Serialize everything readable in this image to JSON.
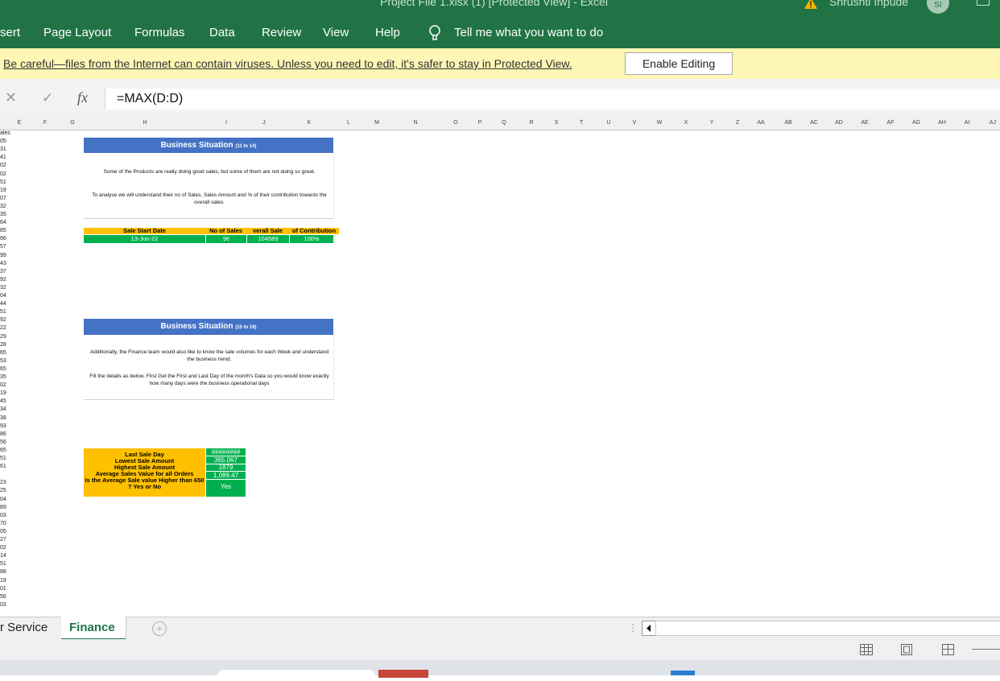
{
  "window": {
    "title": "Project File 1.xlsx (1)  [Protected View]  -  Excel",
    "user": "Shrushti Inpude",
    "avatar_initials": "SI"
  },
  "ribbon": {
    "tabs": [
      "sert",
      "Page Layout",
      "Formulas",
      "Data",
      "Review",
      "View",
      "Help"
    ],
    "tell_me": "Tell me what you want to do"
  },
  "protected_view": {
    "message": "Be careful—files from the Internet can contain viruses. Unless you need to edit, it's safer to stay in Protected View.",
    "enable_button": "Enable Editing"
  },
  "formula_bar": {
    "cancel_glyph": "✕",
    "enter_glyph": "✓",
    "fx_label": "fx",
    "formula": "=MAX(D:D)"
  },
  "columns": [
    "E",
    "F",
    "G",
    "H",
    "I",
    "J",
    "K",
    "L",
    "M",
    "N",
    "O",
    "P",
    "Q",
    "R",
    "S",
    "T",
    "U",
    "V",
    "W",
    "X",
    "Y",
    "Z",
    "AA",
    "AB",
    "AC",
    "AD",
    "AE",
    "AF",
    "AG",
    "AH",
    "AI",
    "AJ"
  ],
  "row_fragments": [
    "ales",
    "05",
    "31",
    "41",
    "02",
    "02",
    "51",
    "19",
    "07",
    "32",
    "35",
    "64",
    "85",
    "66",
    "57",
    "99",
    "43",
    "37",
    "92",
    "32",
    "04",
    "44",
    "51",
    "92",
    "22",
    "29",
    "28",
    "65",
    "53",
    "65",
    "35",
    "02",
    "19",
    "45",
    "34",
    "38",
    "93",
    "86",
    "56",
    "65",
    "51",
    "61",
    "",
    "23",
    "25",
    "04",
    "89",
    "03",
    "70",
    "05",
    "27",
    "02",
    "14",
    "51",
    "88",
    "19",
    "01",
    "56",
    "03"
  ],
  "section1": {
    "title": "Business Situation",
    "title_suffix": "(11 to 14)",
    "para1": "Some of the Products are really doing good sales, but some of them are not doing so great.",
    "para2": "To analyse we will understand their no of Sales, Sales Amount and % of their contribution towards the overall sales.",
    "table": {
      "headers": [
        "Sale Start Date",
        "No of Sales",
        "Overall Sale",
        "% of Contribution"
      ],
      "header_display": [
        "Sale Start Date",
        "No of Sales",
        "verall Sale",
        "of Contribution"
      ],
      "row": [
        "13-Jun-22",
        "96",
        "104589",
        "100%"
      ]
    }
  },
  "section2": {
    "title": "Business Situation",
    "title_suffix": "(15 to 16)",
    "para1": "Additionally, the Finance team would also like to know the sale volumes for each Week and understand the business trend.",
    "para2": "Fill the details as below. First Get the First and Last Day of the month's Data so you would know exactly how many days were the business operational days"
  },
  "summary": [
    {
      "label": "Last Sale Day",
      "value": "########"
    },
    {
      "label": "Lowest Sale Amount",
      "value": "365.067"
    },
    {
      "label": "Highest Sale Amount",
      "value": "1879"
    },
    {
      "label": "Average Sales Value for all Orders",
      "value": "1,089.47"
    },
    {
      "label": "Is the Average Sale value Higher than 650 ? Yes or No",
      "value": "Yes"
    }
  ],
  "sheets": {
    "tab1": "r Service",
    "tab2": "Finance",
    "add_glyph": "+"
  },
  "colors": {
    "excel_green": "#217346",
    "banner_yellow": "#fdf6b5",
    "header_blue": "#4472c4",
    "gold": "#ffc000",
    "green_cell": "#00b050"
  }
}
